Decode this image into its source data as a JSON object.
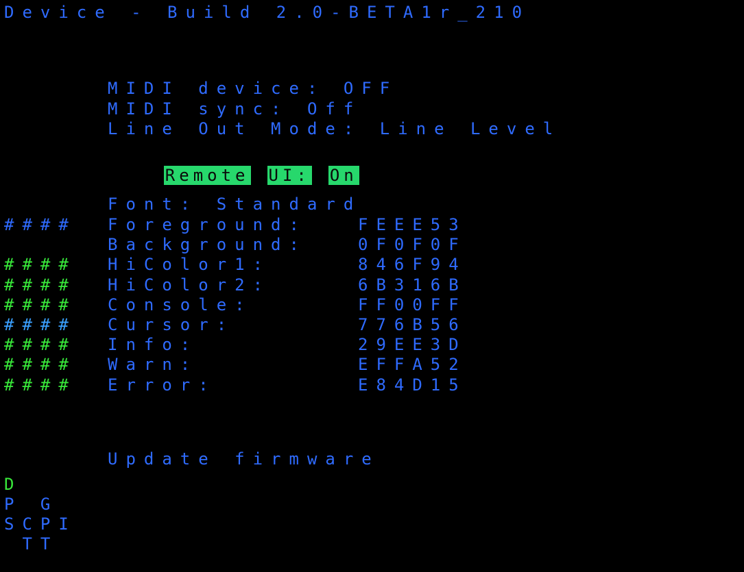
{
  "title": "Device - Build 2.0-BETA1r_210",
  "settings": {
    "midi_device": "MIDI device: OFF",
    "midi_sync": "MIDI sync: Off",
    "line_out": "Line Out Mode: Line Level",
    "remote_ui_label": "Remote",
    "remote_ui_key": "UI:",
    "remote_ui_value": "On"
  },
  "font": "Font: Standard",
  "colors": [
    {
      "hash": "####",
      "hash_color": "#2f6bff",
      "label": "Foreground:",
      "value": "FEEE53"
    },
    {
      "hash": "",
      "hash_color": "#000000",
      "label": "Background:",
      "value": "0F0F0F"
    },
    {
      "hash": "####",
      "hash_color": "#38e83a",
      "label": "HiColor1:",
      "value": "846F94"
    },
    {
      "hash": "####",
      "hash_color": "#38e83a",
      "label": "HiColor2:",
      "value": "6B316B"
    },
    {
      "hash": "####",
      "hash_color": "#38e83a",
      "label": "Console:",
      "value": "FF00FF"
    },
    {
      "hash": "####",
      "hash_color": "#3aa0ff",
      "label": "Cursor:",
      "value": "776B56"
    },
    {
      "hash": "####",
      "hash_color": "#38e83a",
      "label": "Info:",
      "value": "29EE3D"
    },
    {
      "hash": "####",
      "hash_color": "#38e83a",
      "label": "Warn:",
      "value": "EFFA52"
    },
    {
      "hash": "####",
      "hash_color": "#38e83a",
      "label": "Error:",
      "value": "E84D15"
    }
  ],
  "update_firmware": "Update firmware",
  "minimap": {
    "row1": "D",
    "row2": "P G",
    "row3": "SCPI",
    "row4": " TT"
  },
  "palette": {
    "text": "#2f6bff",
    "highlight_bg": "#27d86c",
    "highlight_text": "#0a0a0a",
    "minimap_active": "#38e83a"
  }
}
